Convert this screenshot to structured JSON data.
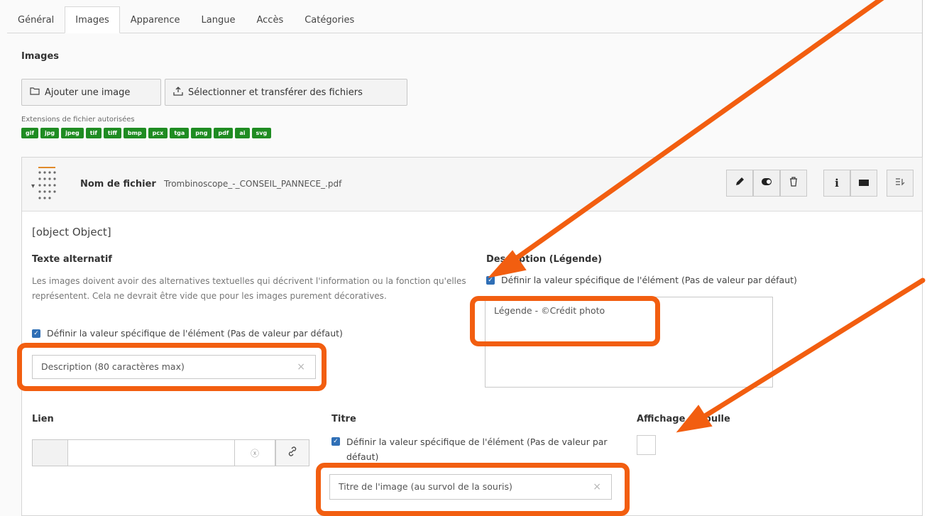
{
  "tabs": [
    "Général",
    "Images",
    "Apparence",
    "Langue",
    "Accès",
    "Catégories"
  ],
  "section_title": "Images",
  "buttons": {
    "add_image": "Ajouter une image",
    "upload": "Sélectionner et transférer des fichiers"
  },
  "extensions": {
    "label": "Extensions de fichier autorisées",
    "items": [
      "gif",
      "jpg",
      "jpeg",
      "tif",
      "tiff",
      "bmp",
      "pcx",
      "tga",
      "png",
      "pdf",
      "ai",
      "svg"
    ]
  },
  "file": {
    "label": "Nom de fichier",
    "name": "Trombinoscope_-_CONSEIL_PANNECE_.pdf"
  },
  "metadata": {
    "title": {
      "label": "Titre",
      "checkbox": "Définir la valeur spécifique de l'élément (Pas de valeur par défaut)",
      "value": "Titre de l'image (au survol de la souris)"
    },
    "alt": {
      "label": "Texte alternatif",
      "help": "Les images doivent avoir des alternatives textuelles qui décrivent l'information ou la fonction qu'elles représentent. Cela ne devrait être vide que pour les images purement décoratives.",
      "checkbox": "Définir la valeur spécifique de l'élément (Pas de valeur par défaut)",
      "value": "Description (80 caractères max)"
    },
    "description": {
      "label": "Description (Légende)",
      "checkbox": "Définir la valeur spécifique de l'élément (Pas de valeur par défaut)",
      "value": "Légende - ©Crédit photo"
    },
    "link": {
      "label": "Lien"
    },
    "tooltip": {
      "label": "Affichage en bulle"
    }
  },
  "colors": {
    "annotation": "#f25e10",
    "checkbox": "#2f6fb6",
    "extension_badge": "#1f8c22"
  }
}
